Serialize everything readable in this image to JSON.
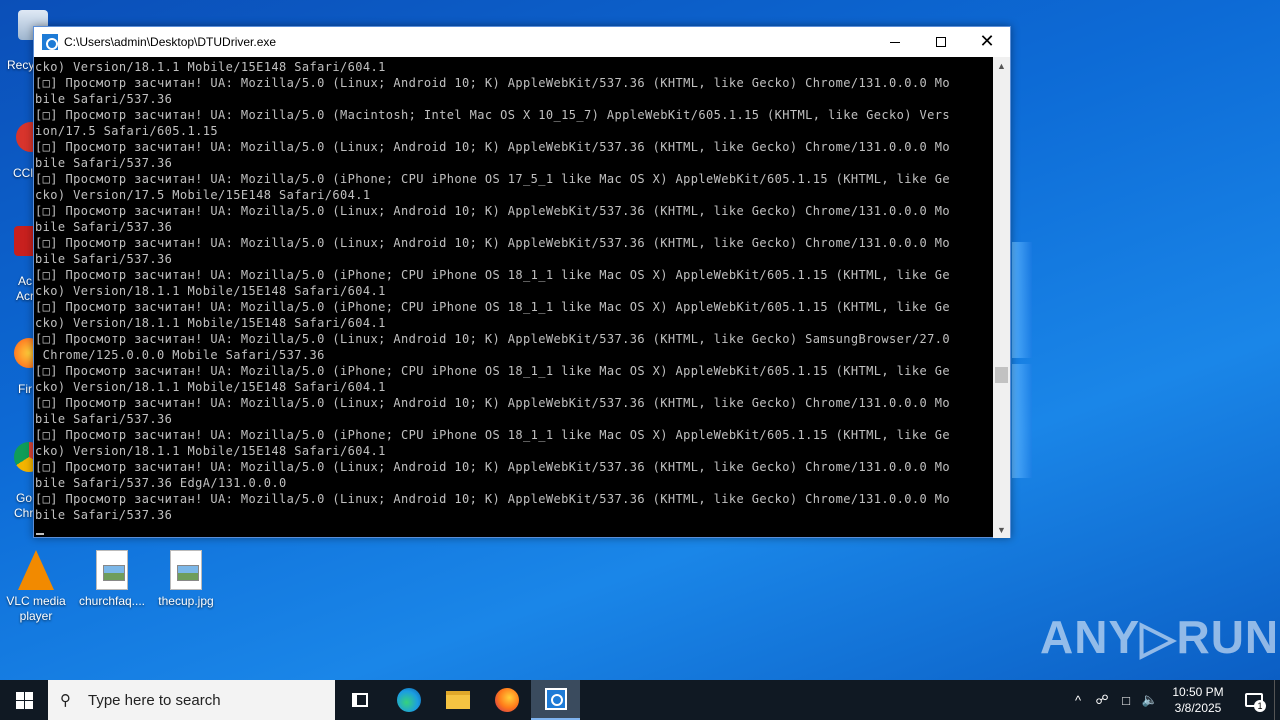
{
  "desktop": {
    "partial_labels": [
      "Recycle",
      "CCl",
      "Ac",
      "Acr",
      "Fir",
      "Go",
      "Chr"
    ],
    "icons": [
      {
        "label": "VLC media player"
      },
      {
        "label": "churchfaq...."
      },
      {
        "label": "thecup.jpg"
      }
    ]
  },
  "console": {
    "title": "C:\\Users\\admin\\Desktop\\DTUDriver.exe",
    "lines": [
      "cko) Version/18.1.1 Mobile/15E148 Safari/604.1",
      "[□] Просмотр засчитан! UA: Mozilla/5.0 (Linux; Android 10; K) AppleWebKit/537.36 (KHTML, like Gecko) Chrome/131.0.0.0 Mo",
      "bile Safari/537.36",
      "[□] Просмотр засчитан! UA: Mozilla/5.0 (Macintosh; Intel Mac OS X 10_15_7) AppleWebKit/605.1.15 (KHTML, like Gecko) Vers",
      "ion/17.5 Safari/605.1.15",
      "[□] Просмотр засчитан! UA: Mozilla/5.0 (Linux; Android 10; K) AppleWebKit/537.36 (KHTML, like Gecko) Chrome/131.0.0.0 Mo",
      "bile Safari/537.36",
      "[□] Просмотр засчитан! UA: Mozilla/5.0 (iPhone; CPU iPhone OS 17_5_1 like Mac OS X) AppleWebKit/605.1.15 (KHTML, like Ge",
      "cko) Version/17.5 Mobile/15E148 Safari/604.1",
      "[□] Просмотр засчитан! UA: Mozilla/5.0 (Linux; Android 10; K) AppleWebKit/537.36 (KHTML, like Gecko) Chrome/131.0.0.0 Mo",
      "bile Safari/537.36",
      "[□] Просмотр засчитан! UA: Mozilla/5.0 (Linux; Android 10; K) AppleWebKit/537.36 (KHTML, like Gecko) Chrome/131.0.0.0 Mo",
      "bile Safari/537.36",
      "[□] Просмотр засчитан! UA: Mozilla/5.0 (iPhone; CPU iPhone OS 18_1_1 like Mac OS X) AppleWebKit/605.1.15 (KHTML, like Ge",
      "cko) Version/18.1.1 Mobile/15E148 Safari/604.1",
      "[□] Просмотр засчитан! UA: Mozilla/5.0 (iPhone; CPU iPhone OS 18_1_1 like Mac OS X) AppleWebKit/605.1.15 (KHTML, like Ge",
      "cko) Version/18.1.1 Mobile/15E148 Safari/604.1",
      "[□] Просмотр засчитан! UA: Mozilla/5.0 (Linux; Android 10; K) AppleWebKit/537.36 (KHTML, like Gecko) SamsungBrowser/27.0",
      " Chrome/125.0.0.0 Mobile Safari/537.36",
      "[□] Просмотр засчитан! UA: Mozilla/5.0 (iPhone; CPU iPhone OS 18_1_1 like Mac OS X) AppleWebKit/605.1.15 (KHTML, like Ge",
      "cko) Version/18.1.1 Mobile/15E148 Safari/604.1",
      "[□] Просмотр засчитан! UA: Mozilla/5.0 (Linux; Android 10; K) AppleWebKit/537.36 (KHTML, like Gecko) Chrome/131.0.0.0 Mo",
      "bile Safari/537.36",
      "[□] Просмотр засчитан! UA: Mozilla/5.0 (iPhone; CPU iPhone OS 18_1_1 like Mac OS X) AppleWebKit/605.1.15 (KHTML, like Ge",
      "cko) Version/18.1.1 Mobile/15E148 Safari/604.1",
      "[□] Просмотр засчитан! UA: Mozilla/5.0 (Linux; Android 10; K) AppleWebKit/537.36 (KHTML, like Gecko) Chrome/131.0.0.0 Mo",
      "bile Safari/537.36 EdgA/131.0.0.0",
      "[□] Просмотр засчитан! UA: Mozilla/5.0 (Linux; Android 10; K) AppleWebKit/537.36 (KHTML, like Gecko) Chrome/131.0.0.0 Mo",
      "bile Safari/537.36"
    ]
  },
  "watermark": "ANY▷RUN",
  "taskbar": {
    "search_placeholder": "Type here to search",
    "time": "10:50 PM",
    "date": "3/8/2025",
    "notification_count": "1"
  },
  "colors": {
    "console_bg": "#000000",
    "console_text": "#c0c0c0",
    "taskbar_bg": "#101923",
    "desktop_blue": "#0d6bd6"
  }
}
